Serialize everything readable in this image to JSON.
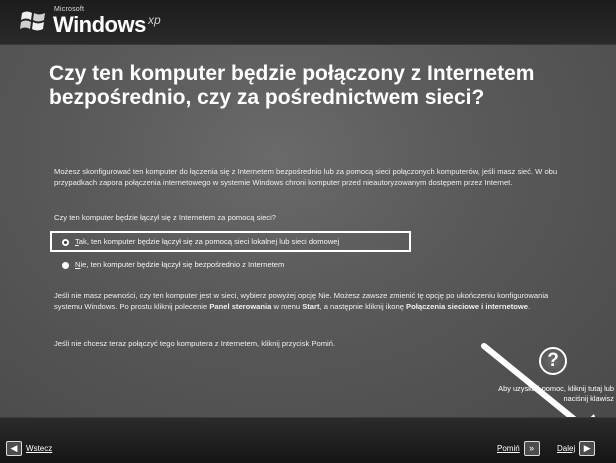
{
  "header": {
    "brand_small": "Microsoft",
    "brand": "Windows",
    "brand_suffix": "xp"
  },
  "page": {
    "title": "Czy ten komputer będzie połączony z Internetem bezpośrednio, czy za pośrednictwem sieci?",
    "intro": "Możesz skonfigurować ten komputer do łączenia się z Internetem bezpośrednio lub za pomocą sieci połączonych komputerów, jeśli masz sieć. W obu przypadkach zapora połączenia internetowego w systemie Windows chroni komputer przed nieautoryzowanym dostępem przez Internet.",
    "question": "Czy ten komputer będzie łączył się z Internetem za pomocą sieci?",
    "options": [
      {
        "mnemonic": "T",
        "rest": "ak, ten komputer będzie łączył się za pomocą sieci lokalnej lub sieci domowej",
        "selected": true
      },
      {
        "mnemonic": "N",
        "rest": "ie, ten komputer będzie łączył się bezpośrednio z Internetem",
        "selected": false
      }
    ],
    "tip_part1": "Jeśli nie masz pewności, czy ten komputer jest w sieci, wybierz powyżej opcję Nie. Możesz zawsze zmienić tę opcję po ukończeniu konfigurowania systemu Windows. Po prostu kliknij polecenie ",
    "tip_bold1": "Panel sterowania",
    "tip_part2": " w menu ",
    "tip_bold2": "Start",
    "tip_part3": ", a następnie kliknij ikonę ",
    "tip_bold3": "Połączenia sieciowe i internetowe",
    "tip_part4": ".",
    "skip_note": "Jeśli nie chcesz teraz połączyć tego komputera z Internetem, kliknij przycisk Pomiń.",
    "help_symbol": "?",
    "help_text": "Aby uzyskać pomoc, kliknij tutaj lub naciśnij klawisz"
  },
  "nav": {
    "back_mnemonic": "W",
    "back_rest": "stecz",
    "skip_mnemonic": "P",
    "skip_rest": "omiń",
    "next_mnemonic": "D",
    "next_rest": "alej",
    "back_icon": "arrow-left-icon",
    "skip_icon": "fast-forward-icon",
    "next_icon": "arrow-right-icon"
  },
  "colors": {
    "background": "#595959",
    "accent": "#ffffff"
  }
}
